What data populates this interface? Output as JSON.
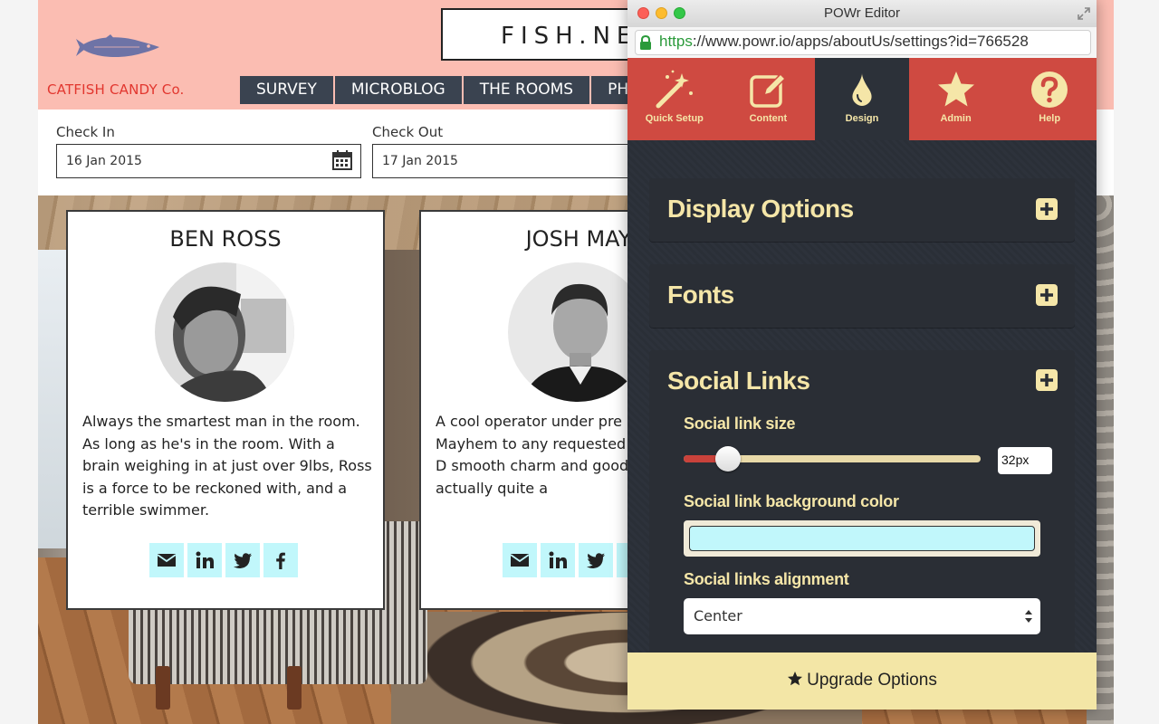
{
  "site": {
    "brand": "CATFISH CANDY Co.",
    "title": "FISH.NE",
    "menu": [
      "SURVEY",
      "MICROBLOG",
      "THE ROOMS",
      "PH"
    ],
    "check_in": {
      "label": "Check In",
      "value": "16 Jan 2015"
    },
    "check_out": {
      "label": "Check Out",
      "value": "17 Jan 2015"
    },
    "cards": [
      {
        "name": "BEN ROSS",
        "text": "Always the smartest man in the room.  As long as he's in the room.  With a brain weighing in at just over 9lbs, Ross is a force to be reckoned with, and a terrible swimmer."
      },
      {
        "name": "JOSH MAY",
        "text": "A cool operator under pre brings the Mayhem to any requested or otherwise.  D smooth charm and good lo you.  He's actually quite a"
      }
    ],
    "social_icons": [
      "email-icon",
      "linkedin-icon",
      "twitter-icon",
      "facebook-icon"
    ]
  },
  "editor": {
    "window_title": "POWr Editor",
    "url_scheme": "https",
    "url_rest": "://www.powr.io/apps/aboutUs/settings?id=766528",
    "tabs": [
      {
        "label": "Quick Setup",
        "icon": "magic-wand-icon",
        "active": false
      },
      {
        "label": "Content",
        "icon": "edit-icon",
        "active": false
      },
      {
        "label": "Design",
        "icon": "drop-icon",
        "active": true
      },
      {
        "label": "Admin",
        "icon": "star-icon",
        "active": false
      },
      {
        "label": "Help",
        "icon": "help-icon",
        "active": false
      }
    ],
    "sections": {
      "display_options": "Display Options",
      "fonts": "Fonts",
      "social_links": "Social Links"
    },
    "social_link_size": {
      "label": "Social link size",
      "value": "32px",
      "slider_fraction": 0.15
    },
    "social_link_bg": {
      "label": "Social link background color",
      "color": "#c1f7fb"
    },
    "social_links_alignment": {
      "label": "Social links alignment",
      "value": "Center"
    },
    "upgrade": "Upgrade Options"
  },
  "colors": {
    "header_pink": "#fbbdb2",
    "brand_red": "#e2372f",
    "nav_dark": "#3a4350",
    "editor_tab_red": "#cf4a41",
    "editor_bg": "#2c3139",
    "editor_text_yellow": "#f5e6a8",
    "upgrade_bg": "#f3e6a6"
  }
}
